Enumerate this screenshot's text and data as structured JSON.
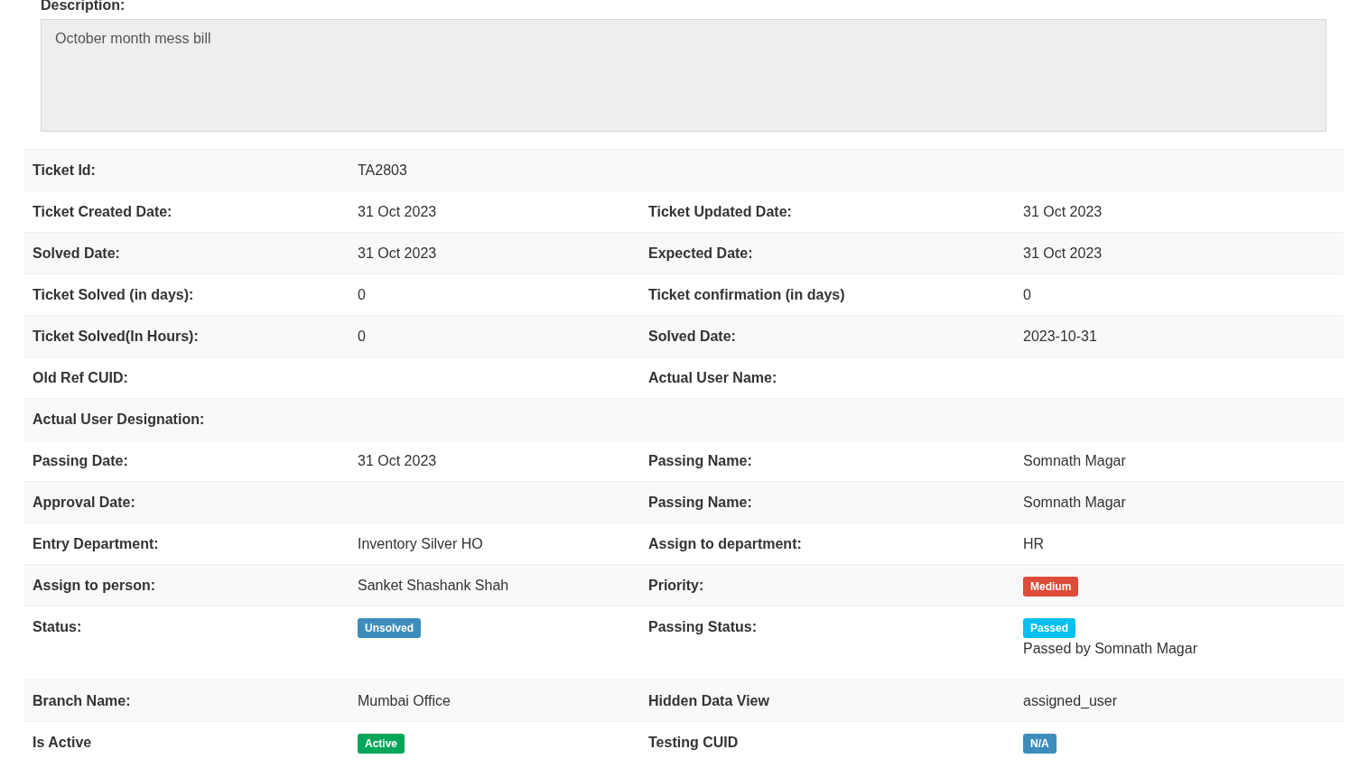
{
  "description": {
    "label": "Description:",
    "value": "October month mess bill"
  },
  "rows": [
    {
      "cells": [
        {
          "label": "Ticket Id:",
          "value": {
            "kind": "text",
            "text": "TA2803"
          }
        }
      ]
    },
    {
      "cells": [
        {
          "label": "Ticket Created Date:",
          "value": {
            "kind": "text",
            "text": "31 Oct 2023"
          }
        },
        {
          "label": "Ticket Updated Date:",
          "value": {
            "kind": "text",
            "text": "31 Oct 2023"
          }
        }
      ]
    },
    {
      "cells": [
        {
          "label": "Solved Date:",
          "value": {
            "kind": "text",
            "text": "31 Oct 2023"
          }
        },
        {
          "label": "Expected Date:",
          "value": {
            "kind": "text",
            "text": "31 Oct 2023"
          }
        }
      ]
    },
    {
      "cells": [
        {
          "label": "Ticket Solved (in days):",
          "value": {
            "kind": "text",
            "text": "0"
          }
        },
        {
          "label": "Ticket confirmation (in days)",
          "value": {
            "kind": "text",
            "text": "0"
          }
        }
      ]
    },
    {
      "cells": [
        {
          "label": "Ticket Solved(In Hours):",
          "value": {
            "kind": "text",
            "text": "0"
          }
        },
        {
          "label": "Solved Date:",
          "value": {
            "kind": "text",
            "text": "2023-10-31"
          }
        }
      ]
    },
    {
      "cells": [
        {
          "label": "Old Ref CUID:"
        },
        {
          "label": "Actual User Name:"
        }
      ]
    },
    {
      "cells": [
        {
          "label": "Actual User Designation:"
        }
      ]
    },
    {
      "cells": [
        {
          "label": "Passing Date:",
          "value": {
            "kind": "text",
            "text": "31 Oct 2023"
          }
        },
        {
          "label": "Passing Name:",
          "value": {
            "kind": "text",
            "text": "Somnath Magar"
          }
        }
      ]
    },
    {
      "cells": [
        {
          "label": "Approval Date:"
        },
        {
          "label": "Passing Name:",
          "value": {
            "kind": "text",
            "text": "Somnath Magar"
          }
        }
      ]
    },
    {
      "cells": [
        {
          "label": "Entry Department:",
          "value": {
            "kind": "text",
            "text": "Inventory Silver HO"
          }
        },
        {
          "label": "Assign to department:",
          "value": {
            "kind": "text",
            "text": "HR"
          }
        }
      ]
    },
    {
      "cells": [
        {
          "label": "Assign to person:",
          "value": {
            "kind": "text",
            "text": "Sanket Shashank Shah"
          }
        },
        {
          "label": "Priority:",
          "value": {
            "kind": "badge",
            "text": "Medium",
            "color": "#dd4b39"
          }
        }
      ]
    },
    {
      "cells": [
        {
          "label": "Status:",
          "value": {
            "kind": "badge",
            "text": "Unsolved",
            "color": "#3c8dbc"
          }
        },
        {
          "label": "Passing Status:",
          "value": {
            "kind": "badge",
            "text": "Passed",
            "color": "#00c0ef",
            "note": "Passed by Somnath Magar"
          }
        }
      ]
    },
    {
      "cells": [
        {
          "label": "Branch Name:",
          "value": {
            "kind": "text",
            "text": "Mumbai Office"
          }
        },
        {
          "label": "Hidden Data View",
          "value": {
            "kind": "text",
            "text": "assigned_user"
          }
        }
      ]
    },
    {
      "cells": [
        {
          "label": "Is Active",
          "value": {
            "kind": "badge",
            "text": "Active",
            "color": "#00a65a"
          }
        },
        {
          "label": "Testing CUID",
          "value": {
            "kind": "badge",
            "text": "N/A",
            "color": "#3c8dbc"
          }
        }
      ]
    }
  ]
}
